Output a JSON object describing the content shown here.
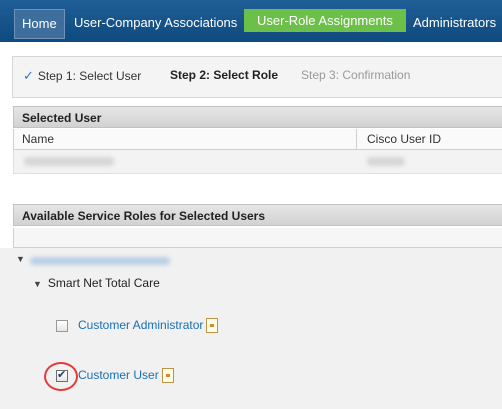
{
  "nav": {
    "items": [
      "Home",
      "User-Company Associations",
      "User-Role Assignments",
      "Administrators"
    ],
    "active": "User-Role Assignments"
  },
  "steps": {
    "step1": "Step 1: Select User",
    "step2": "Step 2: Select Role",
    "step3": "Step 3: Confirmation",
    "step1_icon": "checkmark-icon"
  },
  "selected_user": {
    "header": "Selected User",
    "columns": [
      "Name",
      "Cisco User ID"
    ]
  },
  "roles": {
    "header": "Available Service Roles for Selected Users",
    "category": "Smart Net Total Care",
    "items": [
      {
        "label": "Customer Administrator",
        "checked": false,
        "icon": "info-icon"
      },
      {
        "label": "Customer User",
        "checked": true,
        "icon": "info-icon"
      }
    ]
  },
  "colors": {
    "nav_bg": "#0e4a7e",
    "active_tab": "#6cc04a",
    "link": "#1a6fb4",
    "highlight": "#e23b3b"
  }
}
